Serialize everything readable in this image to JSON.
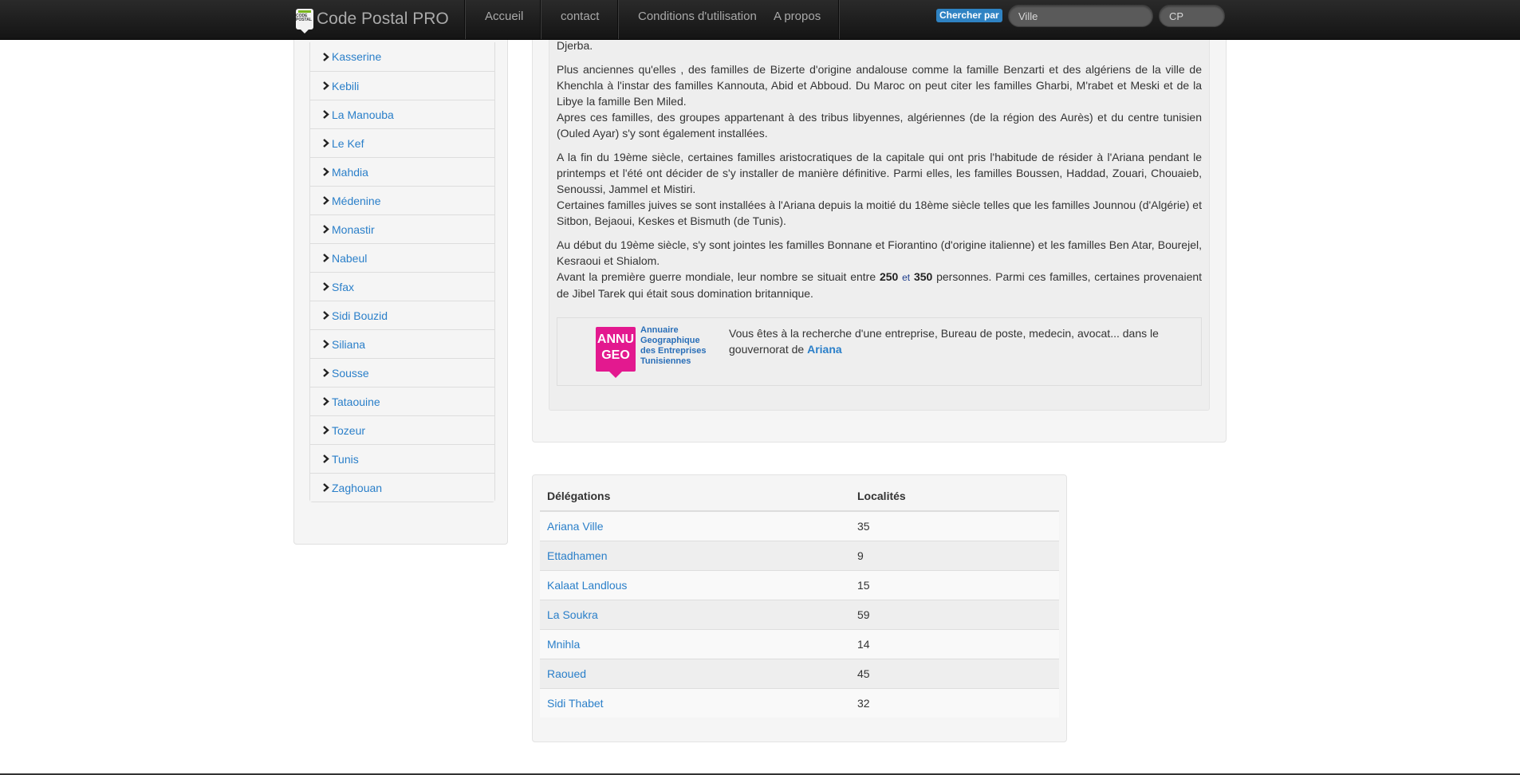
{
  "navbar": {
    "brand": "Code Postal PRO",
    "logo_text": "CODE POSTAL",
    "links": [
      "Accueil",
      "contact",
      "Conditions d'utilisation",
      "A propos"
    ],
    "search_label": "Chercher par",
    "ville_placeholder": "Ville",
    "cp_placeholder": "CP"
  },
  "sidebar": {
    "items": [
      {
        "label": "Kasserine"
      },
      {
        "label": "Kebili"
      },
      {
        "label": "La Manouba"
      },
      {
        "label": "Le Kef"
      },
      {
        "label": "Mahdia"
      },
      {
        "label": "Médenine"
      },
      {
        "label": "Monastir"
      },
      {
        "label": "Nabeul"
      },
      {
        "label": "Sfax"
      },
      {
        "label": "Sidi Bouzid"
      },
      {
        "label": "Siliana"
      },
      {
        "label": "Sousse"
      },
      {
        "label": "Tataouine"
      },
      {
        "label": "Tozeur"
      },
      {
        "label": "Tunis"
      },
      {
        "label": "Zaghouan"
      }
    ]
  },
  "article": {
    "p0_line2": "Djerba.",
    "p1_a": "Plus anciennes qu'elles , des familles de Bizerte d'origine andalouse comme la famille Benzarti et des algériens de la ville de Khenchla à l'instar des familles Kannouta, Abid et Abboud. Du Maroc on peut citer les familles Gharbi, M'rabet et Meski et de la Libye la famille Ben Miled.",
    "p1_b": "Apres ces familles, des groupes appartenant à des tribus libyennes, algériennes (de la région des Aurès) et du centre tunisien (Ouled Ayar) s'y sont également installées.",
    "p2_a": "A la fin du 19ème siècle, certaines familles aristocratiques de la capitale qui ont pris l'habitude de résider à l'Ariana pendant le printemps et l'été ont décider de s'y installer de manière définitive. Parmi elles, les familles Boussen, Haddad, Zouari, Chouaieb, Senoussi, Jammel et Mistiri.",
    "p2_b": "Certaines familles juives se sont installées à l'Ariana depuis la moitié du 18ème siècle telles que les familles Jounnou (d'Algérie) et Sitbon, Bejaoui, Keskes et Bismuth (de Tunis).",
    "p3_a": "Au début du 19ème siècle, s'y sont jointes les familles Bonnane et Fiorantino (d'origine italienne) et les familles Ben Atar, Bourejel, Kesraoui et Shialom.",
    "p3_b_pre": "Avant la première guerre mondiale, leur nombre se situait entre",
    "p3_b_n1": "250",
    "p3_b_et": "et",
    "p3_b_n2": "350",
    "p3_b_post": "personnes. Parmi ces familles, certaines provenaient de Jibel Tarek qui était sous domination britannique."
  },
  "promo": {
    "badge_line1": "ANNU",
    "badge_line2": "GEO",
    "logo_line1": "Annuaire",
    "logo_line2": "Geographique",
    "logo_line3": "des Entreprises",
    "logo_line4": "Tunisiennes",
    "text": "Vous êtes à la recherche d'une entreprise, Bureau de poste, medecin, avocat... dans le gouvernorat de",
    "link": "Ariana"
  },
  "table": {
    "headers": [
      "Délégations",
      "Localités"
    ],
    "rows": [
      {
        "name": "Ariana Ville",
        "count": "35"
      },
      {
        "name": "Ettadhamen",
        "count": "9"
      },
      {
        "name": "Kalaat Landlous",
        "count": "15"
      },
      {
        "name": "La Soukra",
        "count": "59"
      },
      {
        "name": "Mnihla",
        "count": "14"
      },
      {
        "name": "Raoued",
        "count": "45"
      },
      {
        "name": "Sidi Thabet",
        "count": "32"
      }
    ]
  }
}
